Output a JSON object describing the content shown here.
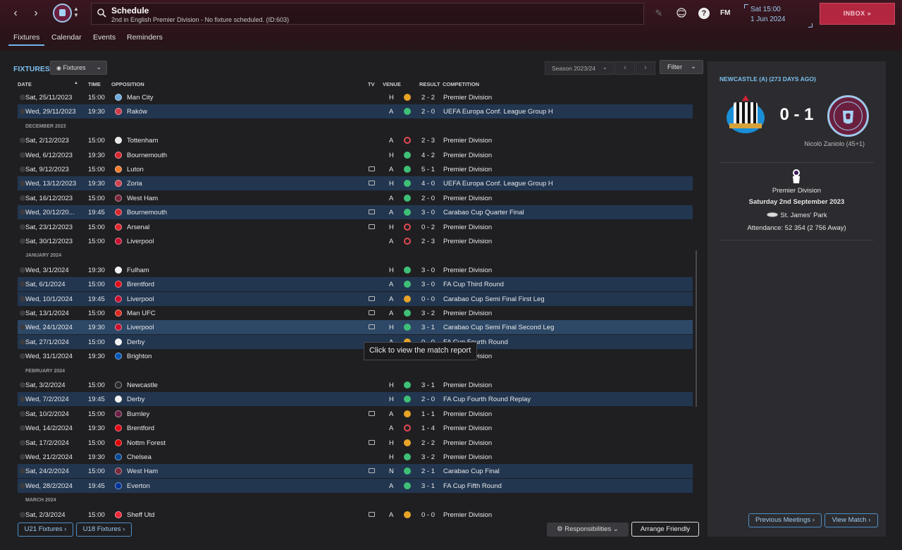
{
  "header": {
    "back_icon": "‹",
    "forward_icon": "›",
    "search_title": "Schedule",
    "search_subtitle": "2nd in English Premier Division - No fixture scheduled. (ID:603)",
    "fm_label": "FM",
    "date_line1": "Sat 15:00",
    "date_line2": "1 Jun 2024",
    "inbox_label": "INBOX  »"
  },
  "tabs": [
    "Fixtures",
    "Calendar",
    "Events",
    "Reminders"
  ],
  "toolbar": {
    "title": "FIXTURES",
    "view_dropdown": "Fixtures",
    "season": "Season 2023/24",
    "filter": "Filter"
  },
  "columns": {
    "date": "DATE",
    "time": "TIME",
    "opposition": "OPPOSITION",
    "tv": "TV",
    "venue": "VENUE",
    "result": "RESULT",
    "competition": "COMPETITION"
  },
  "rows": [
    {
      "date": "Sat, 25/11/2023",
      "time": "15:00",
      "opp": "Man City",
      "tv": false,
      "venue": "H",
      "res": "draw",
      "score": "2 - 2",
      "comp": "Premier Division",
      "hl": false,
      "badge": "#6cabdd"
    },
    {
      "date": "Wed, 29/11/2023",
      "time": "19:30",
      "opp": "Raków",
      "tv": false,
      "venue": "A",
      "res": "win",
      "score": "2 - 0",
      "comp": "UEFA Europa Conf. League Group H",
      "hl": true,
      "badge": "#d03a4b"
    },
    {
      "section": "DECEMBER 2023"
    },
    {
      "date": "Sat, 2/12/2023",
      "time": "15:00",
      "opp": "Tottenham",
      "tv": false,
      "venue": "A",
      "res": "loss",
      "score": "2 - 3",
      "comp": "Premier Division",
      "hl": false,
      "badge": "#e8e8e8"
    },
    {
      "date": "Wed, 6/12/2023",
      "time": "19:30",
      "opp": "Bournemouth",
      "tv": false,
      "venue": "H",
      "res": "win",
      "score": "4 - 2",
      "comp": "Premier Division",
      "hl": false,
      "badge": "#d8262e"
    },
    {
      "date": "Sat, 9/12/2023",
      "time": "15:00",
      "opp": "Luton",
      "tv": true,
      "venue": "A",
      "res": "win",
      "score": "5 - 1",
      "comp": "Premier Division",
      "hl": false,
      "badge": "#f07a2a"
    },
    {
      "date": "Wed, 13/12/2023",
      "time": "19:30",
      "opp": "Zoria",
      "tv": true,
      "venue": "H",
      "res": "win",
      "score": "4 - 0",
      "comp": "UEFA Europa Conf. League Group H",
      "hl": true,
      "badge": "#d04050"
    },
    {
      "date": "Sat, 16/12/2023",
      "time": "15:00",
      "opp": "West Ham",
      "tv": false,
      "venue": "A",
      "res": "win",
      "score": "2 - 0",
      "comp": "Premier Division",
      "hl": false,
      "badge": "#7a263a"
    },
    {
      "date": "Wed, 20/12/20...",
      "time": "19:45",
      "opp": "Bournemouth",
      "tv": true,
      "venue": "A",
      "res": "win",
      "score": "3 - 0",
      "comp": "Carabao Cup Quarter Final",
      "hl": true,
      "badge": "#d8262e"
    },
    {
      "date": "Sat, 23/12/2023",
      "time": "15:00",
      "opp": "Arsenal",
      "tv": true,
      "venue": "H",
      "res": "loss",
      "score": "0 - 2",
      "comp": "Premier Division",
      "hl": false,
      "badge": "#e0262d"
    },
    {
      "date": "Sat, 30/12/2023",
      "time": "15:00",
      "opp": "Liverpool",
      "tv": false,
      "venue": "A",
      "res": "loss",
      "score": "2 - 3",
      "comp": "Premier Division",
      "hl": false,
      "badge": "#c8102e"
    },
    {
      "section": "JANUARY 2024"
    },
    {
      "date": "Wed, 3/1/2024",
      "time": "19:30",
      "opp": "Fulham",
      "tv": false,
      "venue": "H",
      "res": "win",
      "score": "3 - 0",
      "comp": "Premier Division",
      "hl": false,
      "badge": "#f2f2f2"
    },
    {
      "date": "Sat, 6/1/2024",
      "time": "15:00",
      "opp": "Brentford",
      "tv": false,
      "venue": "A",
      "res": "win",
      "score": "3 - 0",
      "comp": "FA Cup Third Round",
      "hl": true,
      "badge": "#e30613"
    },
    {
      "date": "Wed, 10/1/2024",
      "time": "19:45",
      "opp": "Liverpool",
      "tv": true,
      "venue": "A",
      "res": "draw",
      "score": "0 - 0",
      "comp": "Carabao Cup Semi Final First Leg",
      "hl": true,
      "badge": "#c8102e"
    },
    {
      "date": "Sat, 13/1/2024",
      "time": "15:00",
      "opp": "Man UFC",
      "tv": true,
      "venue": "A",
      "res": "win",
      "score": "3 - 2",
      "comp": "Premier Division",
      "hl": false,
      "badge": "#da291c"
    },
    {
      "date": "Wed, 24/1/2024",
      "time": "19:30",
      "opp": "Liverpool",
      "tv": true,
      "venue": "H",
      "res": "win",
      "score": "3 - 1",
      "comp": "Carabao Cup Semi Final Second Leg",
      "hl": true,
      "badge": "#c8102e",
      "hover": true
    },
    {
      "date": "Sat, 27/1/2024",
      "time": "15:00",
      "opp": "Derby",
      "tv": false,
      "venue": "A",
      "res": "draw",
      "score": "0 - 0",
      "comp": "FA Cup Fourth Round",
      "hl": true,
      "badge": "#f2f2f2"
    },
    {
      "date": "Wed, 31/1/2024",
      "time": "19:30",
      "opp": "Brighton",
      "tv": false,
      "venue": "A",
      "res": "win",
      "score": "2 - 0",
      "comp": "Premier Division",
      "hl": false,
      "badge": "#0057b8"
    },
    {
      "section": "FEBRUARY 2024"
    },
    {
      "date": "Sat, 3/2/2024",
      "time": "15:00",
      "opp": "Newcastle",
      "tv": false,
      "venue": "H",
      "res": "win",
      "score": "3 - 1",
      "comp": "Premier Division",
      "hl": false,
      "badge": "#2a2a2a"
    },
    {
      "date": "Wed, 7/2/2024",
      "time": "19:45",
      "opp": "Derby",
      "tv": false,
      "venue": "H",
      "res": "win",
      "score": "2 - 0",
      "comp": "FA Cup Fourth Round Replay",
      "hl": true,
      "badge": "#f2f2f2"
    },
    {
      "date": "Sat, 10/2/2024",
      "time": "15:00",
      "opp": "Burnley",
      "tv": true,
      "venue": "A",
      "res": "draw",
      "score": "1 - 1",
      "comp": "Premier Division",
      "hl": false,
      "badge": "#6c1d45"
    },
    {
      "date": "Wed, 14/2/2024",
      "time": "19:30",
      "opp": "Brentford",
      "tv": false,
      "venue": "A",
      "res": "loss",
      "score": "1 - 4",
      "comp": "Premier Division",
      "hl": false,
      "badge": "#e30613"
    },
    {
      "date": "Sat, 17/2/2024",
      "time": "15:00",
      "opp": "Nottm Forest",
      "tv": true,
      "venue": "H",
      "res": "draw",
      "score": "2 - 2",
      "comp": "Premier Division",
      "hl": false,
      "badge": "#dd0000"
    },
    {
      "date": "Wed, 21/2/2024",
      "time": "19:30",
      "opp": "Chelsea",
      "tv": false,
      "venue": "H",
      "res": "win",
      "score": "3 - 2",
      "comp": "Premier Division",
      "hl": false,
      "badge": "#034694"
    },
    {
      "date": "Sat, 24/2/2024",
      "time": "15:00",
      "opp": "West Ham",
      "tv": true,
      "venue": "N",
      "res": "win",
      "score": "2 - 1",
      "comp": "Carabao Cup Final",
      "hl": true,
      "badge": "#7a263a"
    },
    {
      "date": "Wed, 28/2/2024",
      "time": "19:45",
      "opp": "Everton",
      "tv": false,
      "venue": "A",
      "res": "win",
      "score": "3 - 1",
      "comp": "FA Cup Fifth Round",
      "hl": true,
      "badge": "#003399"
    },
    {
      "section": "MARCH 2024"
    },
    {
      "date": "Sat, 2/3/2024",
      "time": "15:00",
      "opp": "Sheff Utd",
      "tv": true,
      "venue": "A",
      "res": "draw",
      "score": "0 - 0",
      "comp": "Premier Division",
      "hl": false,
      "badge": "#ee2737"
    }
  ],
  "tooltip": "Click to view the match report",
  "bottom": {
    "u21": "U21 Fixtures ›",
    "u18": "U18 Fixtures ›",
    "responsibilities": "Responsibilities",
    "arrange": "Arrange Friendly"
  },
  "panel": {
    "title": "NEWCASTLE (A) (273 DAYS AGO)",
    "score": "0 - 1",
    "scorer": "Nicolò Zaniolo (45+1)",
    "competition": "Premier Division",
    "date": "Saturday 2nd September 2023",
    "stadium": "St. James' Park",
    "attendance": "Attendance: 52 354 (2 756 Away)",
    "prev_meetings": "Previous Meetings ›",
    "view_match": "View Match ›"
  },
  "colors": {
    "accent": "#7cc0ee",
    "inbox": "#b2263f",
    "win": "#3fbf76",
    "draw": "#e8a427",
    "loss": "#e04b52",
    "row_highlight": "#223650"
  }
}
